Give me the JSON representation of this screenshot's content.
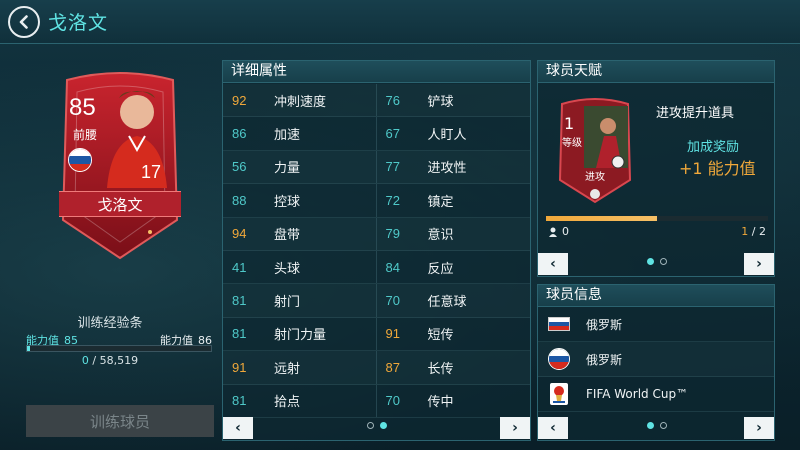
{
  "colors": {
    "accent": "#5fe3e3",
    "highlight": "#f0a83a",
    "card_red": "#b0212c",
    "russia_white": "#ffffff",
    "russia_blue": "#1c57a5",
    "russia_red": "#d52b1e"
  },
  "header": {
    "back_icon": "chevron-left-icon",
    "title": "戈洛文"
  },
  "player_card": {
    "rating": "85",
    "position": "前腰",
    "name": "戈洛文",
    "nation_flag": "russia-flag-icon"
  },
  "training": {
    "title": "训练经验条",
    "current_label": "能力值",
    "current_value": "85",
    "next_label": "能力值",
    "next_value": "86",
    "progress_fraction": 0.0,
    "xp_current": "0",
    "xp_total": "58,519",
    "button_label": "训练球员"
  },
  "attributes": {
    "title": "详细属性",
    "rows": [
      {
        "v1": "92",
        "n1": "冲刺速度",
        "c1": "orange",
        "v2": "76",
        "n2": "铲球",
        "c2": "teal"
      },
      {
        "v1": "86",
        "n1": "加速",
        "c1": "teal",
        "v2": "67",
        "n2": "人盯人",
        "c2": "teal"
      },
      {
        "v1": "56",
        "n1": "力量",
        "c1": "teal",
        "v2": "77",
        "n2": "进攻性",
        "c2": "teal"
      },
      {
        "v1": "88",
        "n1": "控球",
        "c1": "teal",
        "v2": "72",
        "n2": "镇定",
        "c2": "teal"
      },
      {
        "v1": "94",
        "n1": "盘带",
        "c1": "orange",
        "v2": "79",
        "n2": "意识",
        "c2": "teal"
      },
      {
        "v1": "41",
        "n1": "头球",
        "c1": "teal",
        "v2": "84",
        "n2": "反应",
        "c2": "teal"
      },
      {
        "v1": "81",
        "n1": "射门",
        "c1": "teal",
        "v2": "70",
        "n2": "任意球",
        "c2": "teal"
      },
      {
        "v1": "81",
        "n1": "射门力量",
        "c1": "teal",
        "v2": "91",
        "n2": "短传",
        "c2": "orange"
      },
      {
        "v1": "91",
        "n1": "远射",
        "c1": "orange",
        "v2": "87",
        "n2": "长传",
        "c2": "orange"
      },
      {
        "v1": "81",
        "n1": "拾点",
        "c1": "teal",
        "v2": "70",
        "n2": "传中",
        "c2": "teal"
      }
    ],
    "prev_icon": "chevron-left-icon",
    "next_icon": "chevron-right-icon",
    "page": 2,
    "pages": 2
  },
  "talent": {
    "title": "球员天赋",
    "level": "1",
    "level_label": "等级",
    "tag": "进攻",
    "name": "进攻提升道具",
    "bonus_label": "加成奖励",
    "bonus_value": "+1 能力值",
    "progress_fraction": 0.5,
    "count": "0",
    "page_current": "1",
    "page_total": "/ 2",
    "prev_icon": "chevron-left-icon",
    "next_icon": "chevron-right-icon",
    "page": 1,
    "pages": 2
  },
  "info": {
    "title": "球员信息",
    "rows": [
      {
        "icon": "russia-flag-icon",
        "text": "俄罗斯"
      },
      {
        "icon": "russia-badge-icon",
        "text": "俄罗斯"
      },
      {
        "icon": "world-cup-icon",
        "text": "FIFA World Cup™"
      }
    ],
    "prev_icon": "chevron-left-icon",
    "next_icon": "chevron-right-icon",
    "page": 1,
    "pages": 2
  }
}
